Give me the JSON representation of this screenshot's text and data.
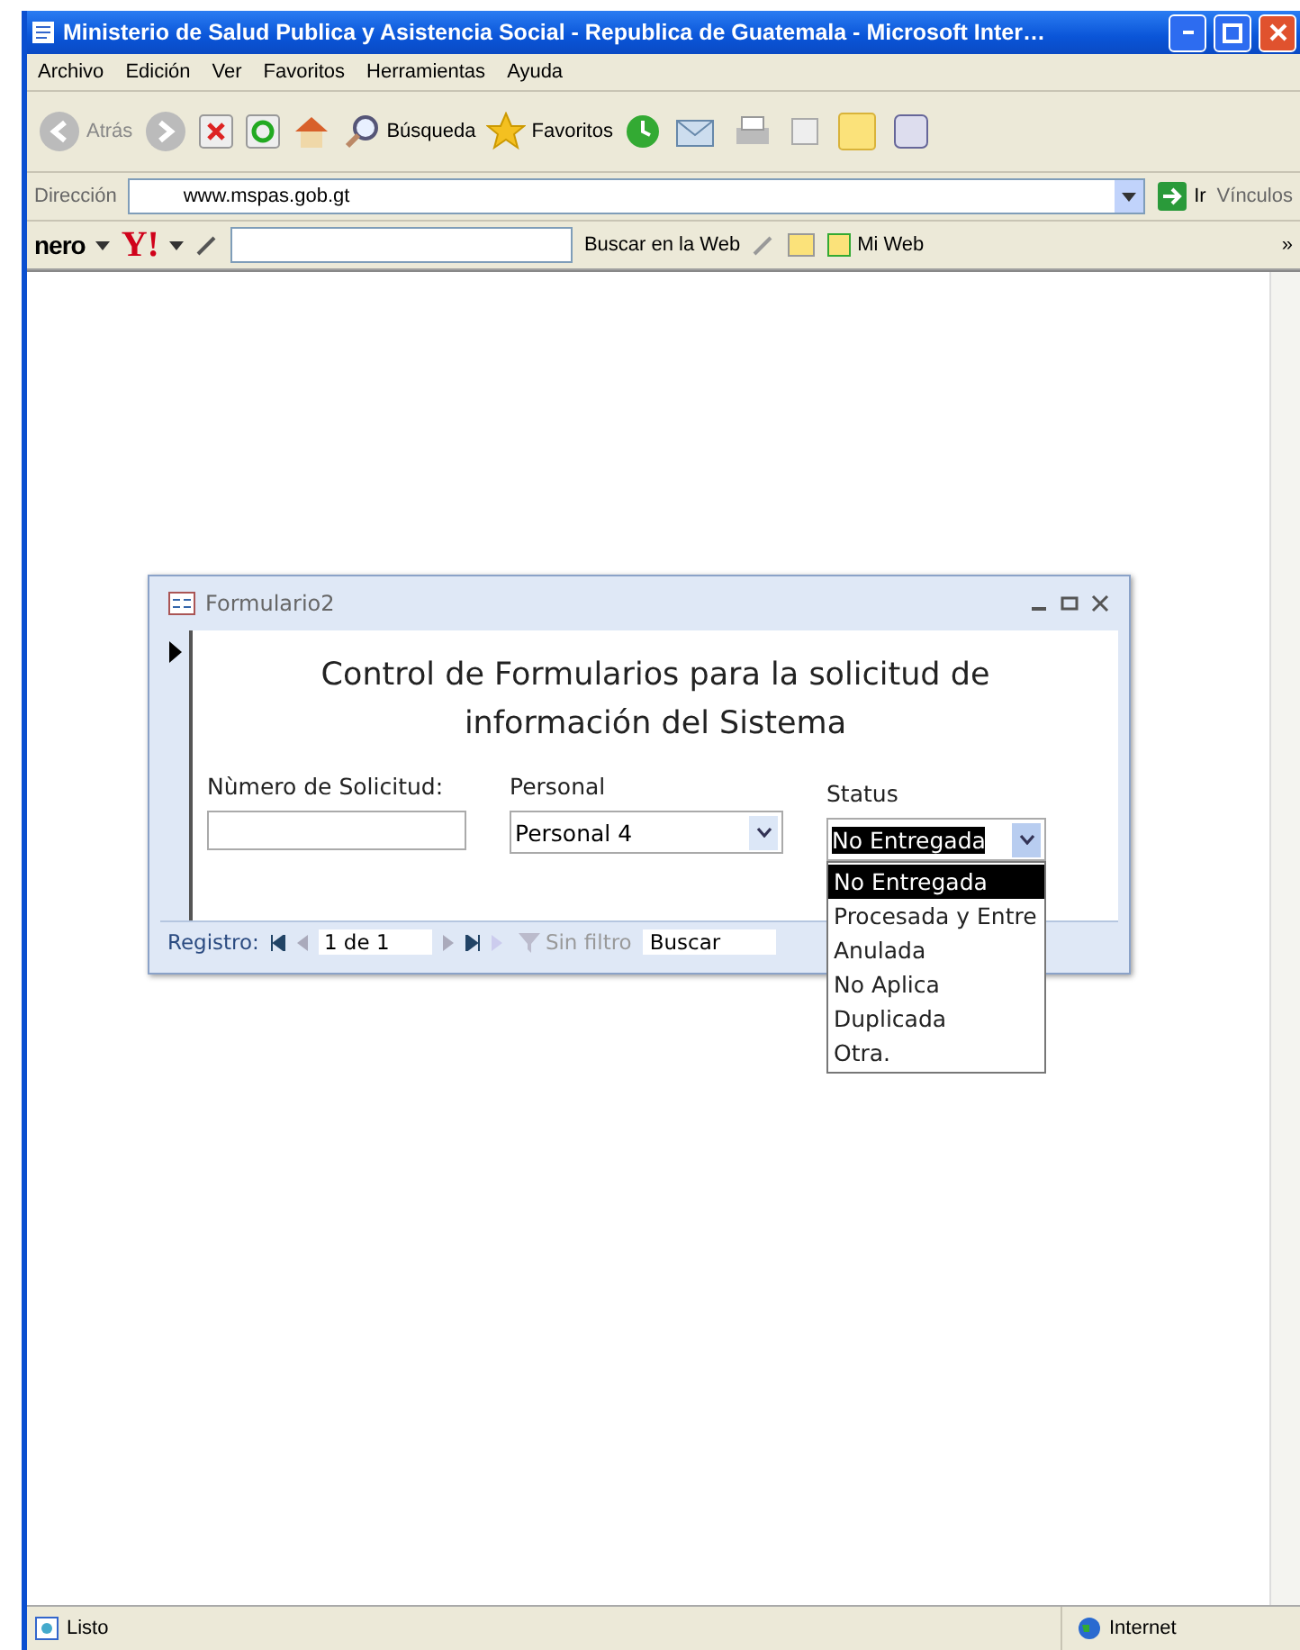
{
  "window": {
    "title": "Ministerio de Salud Publica y Asistencia Social - Republica de Guatemala - Microsoft Inter…"
  },
  "menu": [
    "Archivo",
    "Edición",
    "Ver",
    "Favoritos",
    "Herramientas",
    "Ayuda"
  ],
  "toolbar": {
    "back": "Atrás",
    "search": "Búsqueda",
    "favorites": "Favoritos"
  },
  "address": {
    "label": "Dirección",
    "value": "www.mspas.gob.gt",
    "go": "Ir",
    "links": "Vínculos"
  },
  "search_bar": {
    "logo": "nero",
    "yahoo": "Y!",
    "search_button": "Buscar en la Web",
    "my_web": "Mi Web",
    "more": "»"
  },
  "form": {
    "title": "Formulario2",
    "heading": "Control de Formularios para la solicitud de información del Sistema",
    "fields": [
      {
        "kind": "text",
        "label": "Nùmero de Solicitud:",
        "focused": false
      },
      {
        "kind": "combo",
        "label": "Personal",
        "value": "Personal 4",
        "focused": false
      },
      {
        "kind": "combo",
        "label": "Status",
        "value": "No Entregada",
        "focused": true,
        "expanded": true,
        "options": [
          {
            "label": "No Entregada",
            "selected": true
          },
          {
            "label": "Procesada y Entre",
            "selected": false
          },
          {
            "label": "Anulada",
            "selected": false
          },
          {
            "label": "No Aplica",
            "selected": false
          },
          {
            "label": "Duplicada",
            "selected": false
          },
          {
            "label": "Otra.",
            "selected": false
          }
        ]
      }
    ],
    "navigation": {
      "label": "Registro:",
      "position": "1 de 1",
      "filter": "Sin filtro",
      "search": "Buscar"
    }
  },
  "status_bar": {
    "text": "Listo",
    "zone": "Internet"
  }
}
